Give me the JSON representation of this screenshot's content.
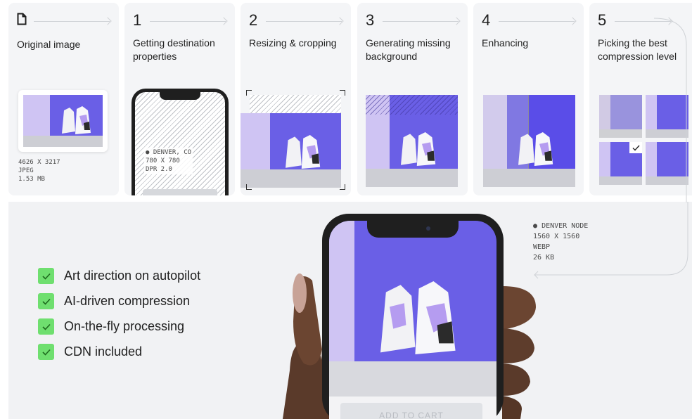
{
  "steps": [
    {
      "num": "",
      "title": "Original image"
    },
    {
      "num": "1",
      "title": "Getting destination properties"
    },
    {
      "num": "2",
      "title": "Resizing & cropping"
    },
    {
      "num": "3",
      "title": "Generating missing background"
    },
    {
      "num": "4",
      "title": "Enhancing"
    },
    {
      "num": "5",
      "title": "Picking the best compression level"
    }
  ],
  "original": {
    "dims": "4626 X 3217",
    "format": "JPEG",
    "size": "1.53 MB"
  },
  "destination": {
    "location": "DENVER, CO",
    "dims": "780 X 780",
    "dpr": "DPR 2.0"
  },
  "node": {
    "location": "DENVER NODE",
    "dims": "1560 X 1560",
    "format": "WEBP",
    "size": "26 KB"
  },
  "features": [
    "Art  direction on autopilot",
    "AI-driven compression",
    "On-the-fly processing",
    "CDN included"
  ],
  "cta": {
    "add_to_cart": "ADD TO CART"
  },
  "icons": {
    "file": "document-icon",
    "pin": "location-pin-icon",
    "check": "checkmark-icon"
  },
  "colors": {
    "accent_purple": "#6a5fe6",
    "lavender": "#cfc4f3",
    "check_green": "#6fdf6f",
    "panel": "#f4f5f7"
  }
}
